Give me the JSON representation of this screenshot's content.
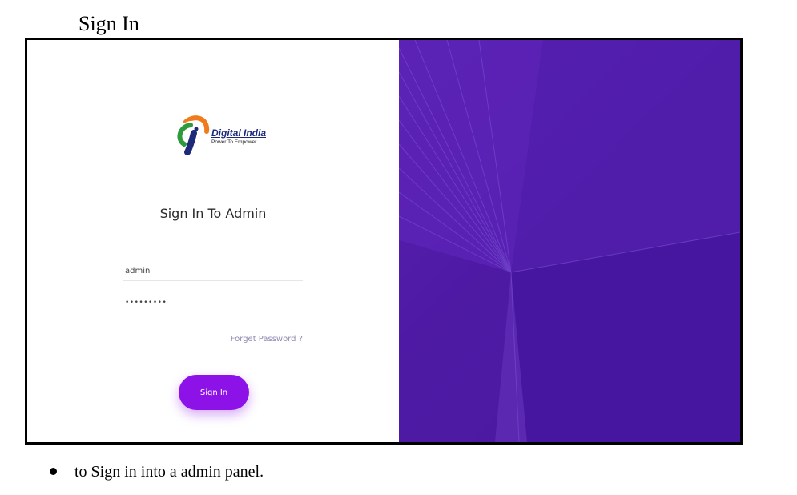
{
  "document": {
    "heading": "Sign In",
    "bullet_text": "to Sign in into a admin panel."
  },
  "login": {
    "logo_name": "Digital India",
    "logo_tagline": "Power To Empower",
    "title": "Sign In To Admin",
    "username_value": "admin",
    "password_value": "•••••••••",
    "forgot_label": "Forget Password ?",
    "signin_label": "Sign In"
  },
  "colors": {
    "panel_purple": "#4d1aa4",
    "button_purple": "#8d12e8",
    "forgot_link": "#8d8aaf"
  },
  "icons": {
    "logo": "digital-india-logo-icon",
    "bullet": "bullet-dot-icon"
  }
}
